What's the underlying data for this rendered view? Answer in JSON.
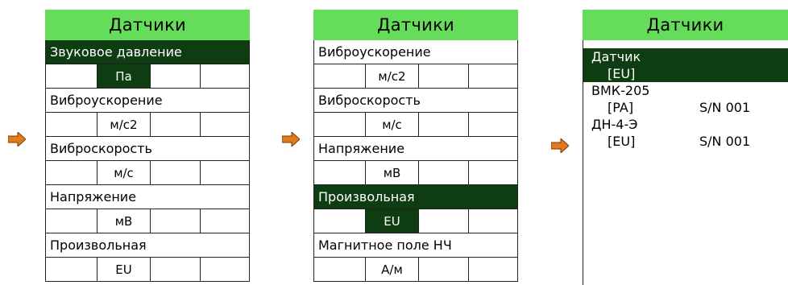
{
  "arrow_color": "#e07a20",
  "screen1": {
    "title": "Датчики",
    "items": [
      {
        "name": "Звуковое давление",
        "unit": "Па",
        "selected": true
      },
      {
        "name": "Виброускорение",
        "unit": "м/с2",
        "selected": false
      },
      {
        "name": "Виброскорость",
        "unit": "м/с",
        "selected": false
      },
      {
        "name": "Напряжение",
        "unit": "мВ",
        "selected": false
      },
      {
        "name": "Произвольная",
        "unit": "EU",
        "selected": false
      }
    ]
  },
  "screen2": {
    "title": "Датчики",
    "items": [
      {
        "name": "Виброускорение",
        "unit": "м/с2",
        "selected": false
      },
      {
        "name": "Виброскорость",
        "unit": "м/с",
        "selected": false
      },
      {
        "name": "Напряжение",
        "unit": "мВ",
        "selected": false
      },
      {
        "name": "Произвольная",
        "unit": "EU",
        "selected": true
      },
      {
        "name": "Магнитное поле НЧ",
        "unit": "А/м",
        "selected": false
      }
    ]
  },
  "screen3": {
    "title": "Датчики",
    "header_line1": "Датчик",
    "header_line2": "[EU]",
    "sensors": [
      {
        "name": "ВМК-205",
        "unit": "[PA]",
        "serial": "S/N 001"
      },
      {
        "name": "ДН-4-Э",
        "unit": "[EU]",
        "serial": "S/N 001"
      }
    ]
  }
}
